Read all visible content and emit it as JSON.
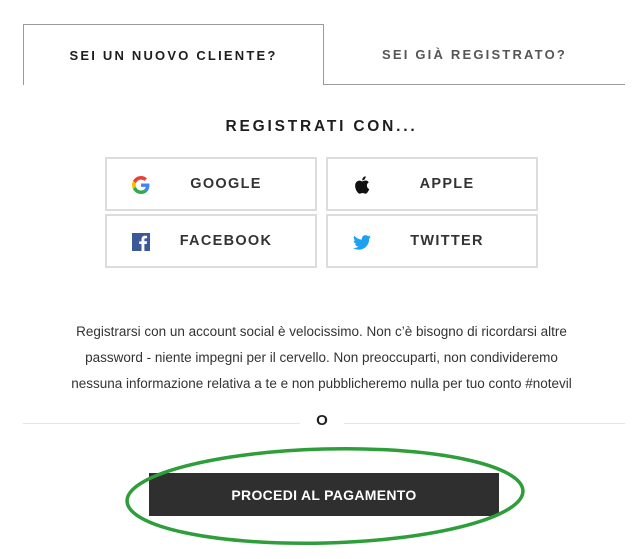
{
  "tabs": {
    "new_customer": "SEI UN NUOVO CLIENTE?",
    "registered": "SEI GIÀ REGISTRATO?"
  },
  "register_title": "REGISTRATI CON...",
  "social": {
    "google": "GOOGLE",
    "apple": "APPLE",
    "facebook": "FACEBOOK",
    "twitter": "TWITTER"
  },
  "info_lines": [
    "Registrarsi con un account social è velocissimo. Non c’è bisogno di ricordarsi altre",
    "password - niente impegni per il cervello. Non preoccuparti, non condivideremo",
    "nessuna informazione relativa a te e non pubblicheremo nulla per tuo conto #notevil"
  ],
  "or_label": "O",
  "checkout_label": "PROCEDI AL PAGAMENTO",
  "colors": {
    "checkout_bg": "#2f2f2f",
    "highlight_ellipse": "#2e9e3a",
    "facebook": "#3b5998",
    "twitter": "#1da1f2"
  },
  "icons": [
    "google-icon",
    "apple-icon",
    "facebook-icon",
    "twitter-icon"
  ]
}
